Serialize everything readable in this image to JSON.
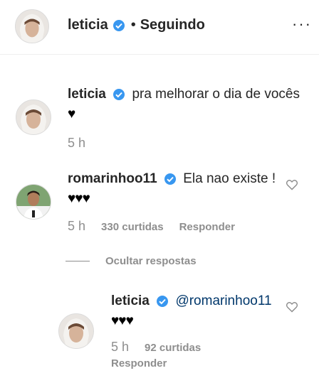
{
  "header": {
    "username": "leticia",
    "separator": "•",
    "follow_status": "Seguindo",
    "more_glyph": "···"
  },
  "caption": {
    "username": "leticia",
    "text": "pra melhorar o dia de vocês",
    "hearts": "♥",
    "time": "5 h"
  },
  "comment": {
    "username": "romarinhoo11",
    "text": "Ela nao existe !",
    "hearts": "♥♥♥",
    "time": "5 h",
    "likes": "330 curtidas",
    "reply_label": "Responder"
  },
  "hide_replies_label": "Ocultar respostas",
  "reply": {
    "username": "leticia",
    "mention": "@romarinhoo11",
    "hearts": "♥♥♥",
    "time": "5 h",
    "likes": "92 curtidas",
    "reply_label": "Responder"
  },
  "colors": {
    "verified": "#3897f0",
    "secondary_text": "#8e8e8e",
    "mention": "#00376b"
  },
  "icons": [
    "verified-badge-icon",
    "more-options-icon",
    "heart-outline-icon"
  ]
}
